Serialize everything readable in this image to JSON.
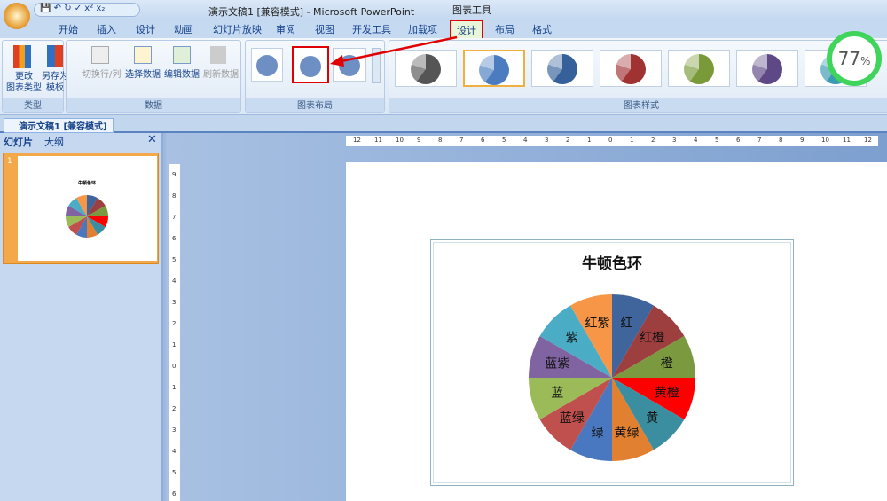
{
  "window": {
    "title": "演示文稿1 [兼容模式] - Microsoft PowerPoint",
    "context_tab": "图表工具"
  },
  "tabs": [
    "开始",
    "插入",
    "设计",
    "动画",
    "幻灯片放映",
    "审阅",
    "视图",
    "开发工具",
    "加载项",
    "设计",
    "布局",
    "格式"
  ],
  "ribbon": {
    "groups": {
      "type": "类型",
      "data": "数据",
      "layout": "图表布局",
      "styles": "图表样式"
    },
    "change_type": "更改\n图表类型",
    "save_template": "另存为\n模板",
    "switch_row_col": "切换行/列",
    "select_data": "选择数据",
    "edit_data": "编辑数据",
    "refresh_data": "刷新数据"
  },
  "document_tab": "演示文稿1 [兼容模式]",
  "left_panel": {
    "tabs": [
      "幻灯片",
      "大纲"
    ],
    "slide_number": "1"
  },
  "zoom_badge": {
    "value": "77",
    "unit": "%"
  },
  "rulers": {
    "horizontal": [
      "12",
      "11",
      "10",
      "9",
      "8",
      "7",
      "6",
      "5",
      "4",
      "3",
      "2",
      "1",
      "0",
      "1",
      "2",
      "3",
      "4",
      "5",
      "6",
      "7",
      "8",
      "9",
      "10",
      "11",
      "12"
    ],
    "vertical": [
      "9",
      "8",
      "7",
      "6",
      "5",
      "4",
      "3",
      "2",
      "1",
      "0",
      "1",
      "2",
      "3",
      "4",
      "5",
      "6"
    ]
  },
  "chart_data": {
    "type": "pie",
    "title": "牛顿色环",
    "categories": [
      "红",
      "红橙",
      "橙",
      "黄橙",
      "黄",
      "黄绿",
      "绿",
      "蓝绿",
      "蓝",
      "蓝紫",
      "紫",
      "红紫"
    ],
    "values": [
      1,
      1,
      1,
      1,
      1,
      1,
      1,
      1,
      1,
      1,
      1,
      1
    ],
    "colors": [
      "#3f659c",
      "#9c3f3e",
      "#7b9a40",
      "#ff0000",
      "#3a8ea0",
      "#e08030",
      "#4a78c0",
      "#c0504d",
      "#9bbb59",
      "#8064a2",
      "#4bacc6",
      "#f79646"
    ]
  },
  "style_colors": [
    "#555555",
    "#4a7cbf",
    "#35609a",
    "#a03232",
    "#7a9a3a",
    "#5e4886",
    "#3a9ab0"
  ],
  "colors": {
    "highlight": "#e00000",
    "badge_ring": "#3fd45a"
  }
}
